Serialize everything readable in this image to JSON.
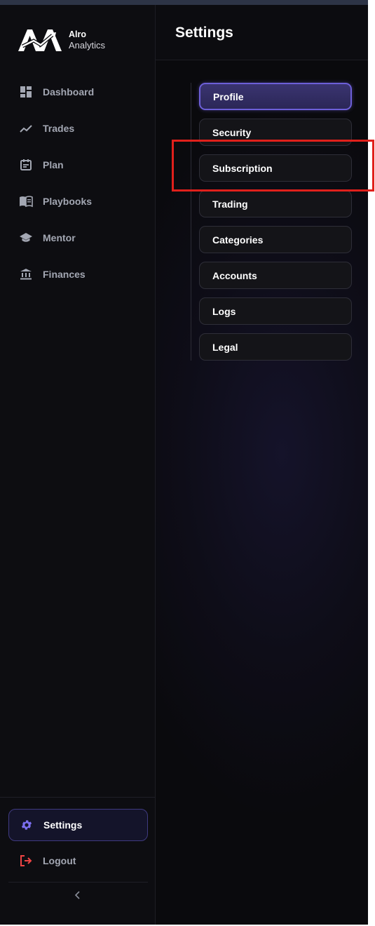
{
  "brand": {
    "name": "Alro",
    "sub": "Analytics"
  },
  "nav": [
    {
      "label": "Dashboard",
      "icon": "dashboard-icon"
    },
    {
      "label": "Trades",
      "icon": "trend-line-icon"
    },
    {
      "label": "Plan",
      "icon": "calendar-icon"
    },
    {
      "label": "Playbooks",
      "icon": "book-icon"
    },
    {
      "label": "Mentor",
      "icon": "graduation-cap-icon"
    },
    {
      "label": "Finances",
      "icon": "bank-icon"
    }
  ],
  "footer": {
    "settings_label": "Settings",
    "logout_label": "Logout",
    "collapse_icon": "chevron-left-icon"
  },
  "header": {
    "title": "Settings"
  },
  "tabs": [
    {
      "label": "Profile",
      "active": true
    },
    {
      "label": "Security"
    },
    {
      "label": "Subscription"
    },
    {
      "label": "Trading"
    },
    {
      "label": "Categories"
    },
    {
      "label": "Accounts"
    },
    {
      "label": "Logs"
    },
    {
      "label": "Legal"
    }
  ],
  "colors": {
    "accent": "#6d5fd8",
    "highlight": "#e0201b",
    "logout": "#ef4444",
    "settings_icon": "#7c6ff0"
  }
}
